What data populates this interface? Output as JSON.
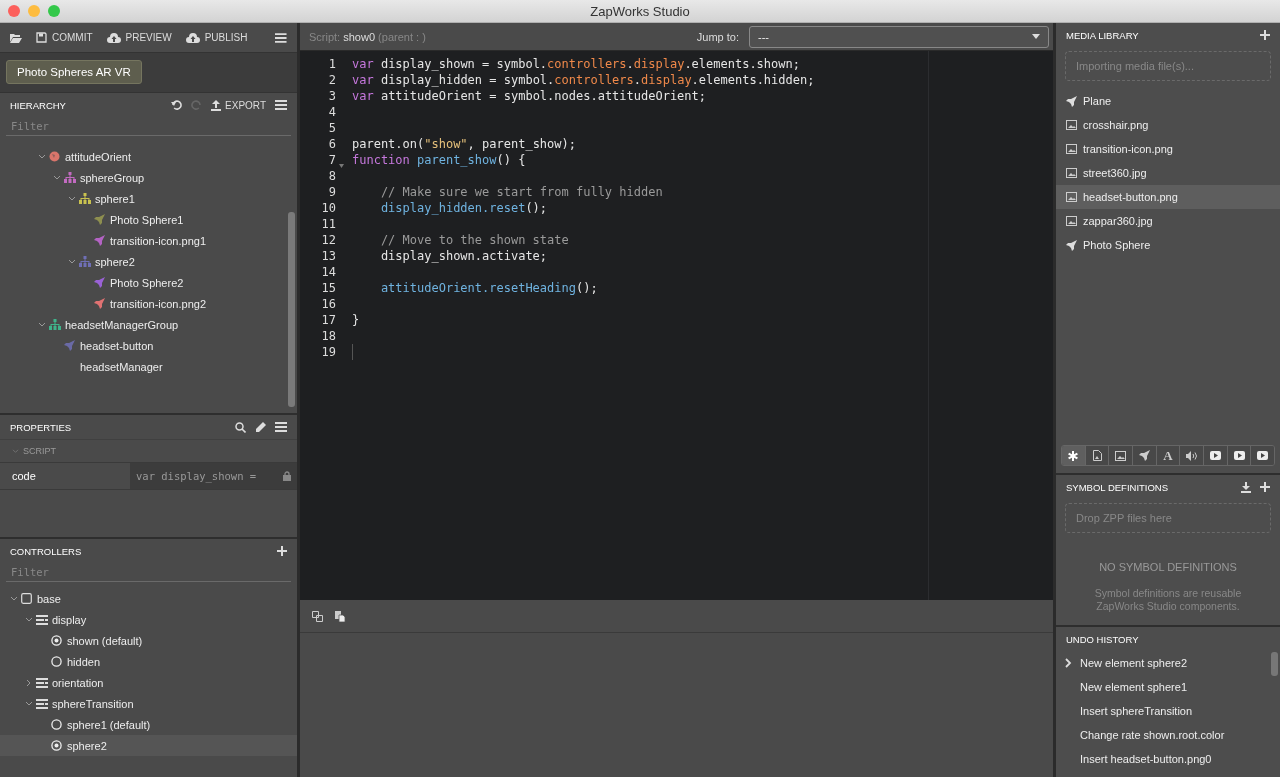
{
  "window": {
    "title": "ZapWorks Studio"
  },
  "toolbar": {
    "buttons": [
      {
        "kind": "open"
      },
      {
        "kind": "commit",
        "label": "COMMIT"
      },
      {
        "kind": "preview",
        "label": "PREVIEW"
      },
      {
        "kind": "publish",
        "label": "PUBLISH"
      }
    ]
  },
  "project": {
    "label": "Photo Spheres AR VR"
  },
  "hierarchy": {
    "title": "HIERARCHY",
    "export": "EXPORT",
    "filter_placeholder": "Filter",
    "items": [
      {
        "label": "attitudeOrient",
        "kind": "globe",
        "color": "#d9756b",
        "expanded": true,
        "children": [
          {
            "label": "sphereGroup",
            "kind": "group",
            "color": "#c36bc2",
            "expanded": true,
            "children": [
              {
                "label": "sphere1",
                "kind": "group",
                "color": "#c9c24f",
                "expanded": true,
                "children": [
                  {
                    "label": "Photo Sphere1",
                    "kind": "rocket",
                    "color": "#8e8f4f"
                  },
                  {
                    "label": "transition-icon.png1",
                    "kind": "rocket",
                    "color": "#b463c4"
                  }
                ]
              },
              {
                "label": "sphere2",
                "kind": "group",
                "color": "#6f6fb5",
                "expanded": true,
                "children": [
                  {
                    "label": "Photo Sphere2",
                    "kind": "rocket",
                    "color": "#9a62d6"
                  },
                  {
                    "label": "transition-icon.png2",
                    "kind": "rocket",
                    "color": "#e07272"
                  }
                ]
              }
            ]
          }
        ]
      },
      {
        "label": "headsetManagerGroup",
        "kind": "group",
        "color": "#3fb38a",
        "expanded": true,
        "children": [
          {
            "label": "headset-button",
            "kind": "rocket",
            "color": "#6a6aa6"
          },
          {
            "label": "headsetManager",
            "kind": "plain"
          }
        ]
      }
    ]
  },
  "properties": {
    "title": "PROPERTIES",
    "section": "SCRIPT",
    "rows": [
      {
        "name": "code",
        "value": "var display_shown =",
        "locked": true
      }
    ]
  },
  "controllers": {
    "title": "CONTROLLERS",
    "filter_placeholder": "Filter",
    "items": [
      {
        "label": "base",
        "kind": "box",
        "expanded": true,
        "children": [
          {
            "label": "display",
            "kind": "controller",
            "expanded": true,
            "children": [
              {
                "label": "shown (default)",
                "kind": "state",
                "selected": true
              },
              {
                "label": "hidden",
                "kind": "state",
                "selected": false
              }
            ]
          },
          {
            "label": "orientation",
            "kind": "controller",
            "expanded": false
          },
          {
            "label": "sphereTransition",
            "kind": "controller",
            "expanded": true,
            "children": [
              {
                "label": "sphere1 (default)",
                "kind": "state",
                "selected": false
              },
              {
                "label": "sphere2",
                "kind": "state",
                "selected": true
              }
            ]
          }
        ]
      }
    ]
  },
  "editor": {
    "script_label": "Script:",
    "script_name": "show0",
    "parent": "(parent : )",
    "jump_label": "Jump to:",
    "jump_value": "---",
    "lines": [
      {
        "number": "1",
        "tokens": [
          {
            "text": "var",
            "kind": "keyword"
          },
          {
            "text": " display_shown = symbol.",
            "kind": "plain"
          },
          {
            "text": "controllers",
            "kind": "property"
          },
          {
            "text": ".",
            "kind": "plain"
          },
          {
            "text": "display",
            "kind": "property"
          },
          {
            "text": ".elements.shown;",
            "kind": "plain"
          }
        ]
      },
      {
        "number": "2",
        "tokens": [
          {
            "text": "var",
            "kind": "keyword"
          },
          {
            "text": " display_hidden = symbol.",
            "kind": "plain"
          },
          {
            "text": "controllers",
            "kind": "property"
          },
          {
            "text": ".",
            "kind": "plain"
          },
          {
            "text": "display",
            "kind": "property"
          },
          {
            "text": ".elements.hidden;",
            "kind": "plain"
          }
        ]
      },
      {
        "number": "3",
        "tokens": [
          {
            "text": "var",
            "kind": "keyword"
          },
          {
            "text": " attitudeOrient = symbol.nodes.attitudeOrient;",
            "kind": "plain"
          }
        ]
      },
      {
        "number": "4"
      },
      {
        "number": "5"
      },
      {
        "number": "6",
        "tokens": [
          {
            "text": "parent.on(",
            "kind": "plain"
          },
          {
            "text": "\"show\"",
            "kind": "string"
          },
          {
            "text": ", parent_show);",
            "kind": "plain"
          }
        ]
      },
      {
        "number": "7",
        "tokens": [
          {
            "text": "function",
            "kind": "keyword"
          },
          {
            "text": " parent_show",
            "kind": "function"
          },
          {
            "text": "() {",
            "kind": "plain"
          }
        ]
      },
      {
        "number": "8"
      },
      {
        "number": "9",
        "tokens": [
          {
            "text": "    // Make sure we start from fully hidden",
            "kind": "comment"
          }
        ]
      },
      {
        "number": "10",
        "tokens": [
          {
            "text": "    display_hidden.reset",
            "kind": "function"
          },
          {
            "text": "();",
            "kind": "plain"
          }
        ]
      },
      {
        "number": "11"
      },
      {
        "number": "12",
        "tokens": [
          {
            "text": "    // Move to the shown state",
            "kind": "comment"
          }
        ]
      },
      {
        "number": "13",
        "tokens": [
          {
            "text": "    display_shown.activate;",
            "kind": "plain"
          }
        ]
      },
      {
        "number": "14"
      },
      {
        "number": "15",
        "tokens": [
          {
            "text": "    attitudeOrient.resetHeading",
            "kind": "function"
          },
          {
            "text": "();",
            "kind": "plain"
          }
        ]
      },
      {
        "number": "16"
      },
      {
        "number": "17",
        "tokens": [
          {
            "text": "}",
            "kind": "plain"
          }
        ]
      },
      {
        "number": "18"
      },
      {
        "number": "19"
      }
    ]
  },
  "media_library": {
    "title": "MEDIA LIBRARY",
    "import_placeholder": "Importing media file(s)...",
    "items": [
      {
        "label": "Plane",
        "kind": "rocket",
        "selected": false
      },
      {
        "label": "crosshair.png",
        "kind": "image",
        "selected": false
      },
      {
        "label": "transition-icon.png",
        "kind": "image",
        "selected": false
      },
      {
        "label": "street360.jpg",
        "kind": "image",
        "selected": false
      },
      {
        "label": "headset-button.png",
        "kind": "image",
        "selected": true
      },
      {
        "label": "zappar360.jpg",
        "kind": "image",
        "selected": false
      },
      {
        "label": "Photo Sphere",
        "kind": "rocket",
        "selected": false
      }
    ],
    "filters": [
      {
        "kind": "all",
        "selected": true
      },
      {
        "kind": "script",
        "selected": false
      },
      {
        "kind": "image",
        "selected": false
      },
      {
        "kind": "rocket",
        "selected": false
      },
      {
        "kind": "font",
        "label": "A",
        "selected": false
      },
      {
        "kind": "audio",
        "selected": false
      },
      {
        "kind": "video",
        "selected": false
      },
      {
        "kind": "video",
        "selected": false
      },
      {
        "kind": "video",
        "selected": false
      }
    ]
  },
  "symbol_definitions": {
    "title": "SYMBOL DEFINITIONS",
    "drop_placeholder": "Drop ZPP files here",
    "empty_title": "NO SYMBOL DEFINITIONS",
    "empty_text": "Symbol definitions are reusable ZapWorks Studio components."
  },
  "undo_history": {
    "title": "UNDO HISTORY",
    "items": [
      {
        "label": "New element sphere2",
        "current": true
      },
      {
        "label": "New element sphere1",
        "current": false
      },
      {
        "label": "Insert sphereTransition",
        "current": false
      },
      {
        "label": "Change rate shown.root.color",
        "current": false
      },
      {
        "label": "Insert headset-button.png0",
        "current": false
      }
    ]
  }
}
